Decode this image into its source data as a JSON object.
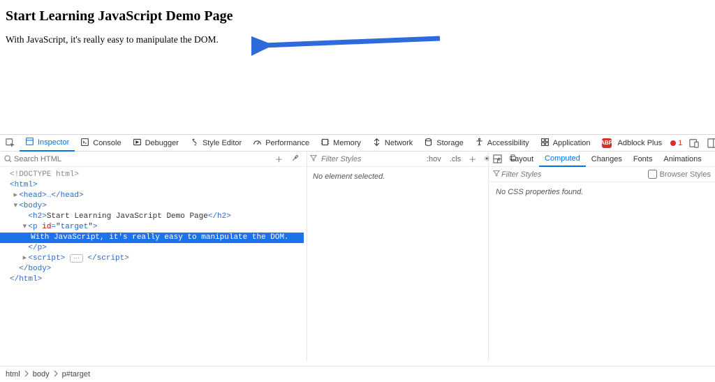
{
  "page": {
    "heading": "Start Learning JavaScript Demo Page",
    "paragraph": "With JavaScript, it's really easy to manipulate the DOM."
  },
  "ui": {
    "arrow_color": "#2d6bdd",
    "search_placeholder": "Search HTML",
    "filter_styles_placeholder": "Filter Styles",
    "hov_label": ":hov",
    "cls_label": ".cls",
    "no_element_selected": "No element selected.",
    "no_css_properties": "No CSS properties found.",
    "browser_styles_label": "Browser Styles",
    "error_count": "1"
  },
  "tabs": [
    {
      "label": "Inspector",
      "active": true,
      "icon": "inspector"
    },
    {
      "label": "Console",
      "icon": "console"
    },
    {
      "label": "Debugger",
      "icon": "debugger"
    },
    {
      "label": "Style Editor",
      "icon": "style"
    },
    {
      "label": "Performance",
      "icon": "perf"
    },
    {
      "label": "Memory",
      "icon": "memory"
    },
    {
      "label": "Network",
      "icon": "network"
    },
    {
      "label": "Storage",
      "icon": "storage"
    },
    {
      "label": "Accessibility",
      "icon": "a11y"
    },
    {
      "label": "Application",
      "icon": "app"
    },
    {
      "label": "Adblock Plus",
      "icon": "abp",
      "pill": "ABP"
    }
  ],
  "right_tabs": [
    {
      "label": "Layout"
    },
    {
      "label": "Computed",
      "active": true
    },
    {
      "label": "Changes"
    },
    {
      "label": "Fonts"
    },
    {
      "label": "Animations"
    }
  ],
  "dom": {
    "lines": [
      {
        "indent": 0,
        "tw": "",
        "html": "<span class='muted'>&lt;!DOCTYPE html&gt;</span>"
      },
      {
        "indent": 0,
        "tw": "",
        "html": "<span class='tag'>&lt;html&gt;</span>"
      },
      {
        "indent": 1,
        "tw": "▸",
        "html": "<span class='tag'>&lt;head&gt;</span><span class='brackets'>…</span><span class='tag'>&lt;/head&gt;</span>"
      },
      {
        "indent": 1,
        "tw": "▾",
        "html": "<span class='tag'>&lt;body&gt;</span>"
      },
      {
        "indent": 2,
        "tw": "",
        "html": "<span class='tag'>&lt;h2&gt;</span><span class='text'>Start Learning JavaScript Demo Page</span><span class='tag'>&lt;/h2&gt;</span>"
      },
      {
        "indent": 2,
        "tw": "▾",
        "html": "<span class='tag'>&lt;p </span><span class='attr'>id</span><span class='tag'>=</span>\"<span class='val'>target</span>\"<span class='tag'>&gt;</span>"
      },
      {
        "indent": 3,
        "tw": "",
        "selected": true,
        "full": true,
        "html": "With JavaScript, it's really easy to manipulate the DOM."
      },
      {
        "indent": 2,
        "tw": "",
        "html": "<span class='tag'>&lt;/p&gt;</span>"
      },
      {
        "indent": 2,
        "tw": "▸",
        "html": "<span class='tag'>&lt;script&gt;</span> <span class='ellipsis-box'>⋯</span> <span class='tag'>&lt;/script&gt;</span>"
      },
      {
        "indent": 1,
        "tw": "",
        "html": "<span class='tag'>&lt;/body&gt;</span>"
      },
      {
        "indent": 0,
        "tw": "",
        "html": "<span class='tag'>&lt;/html&gt;</span>"
      }
    ]
  },
  "breadcrumb": [
    "html",
    "body",
    "p#target"
  ]
}
